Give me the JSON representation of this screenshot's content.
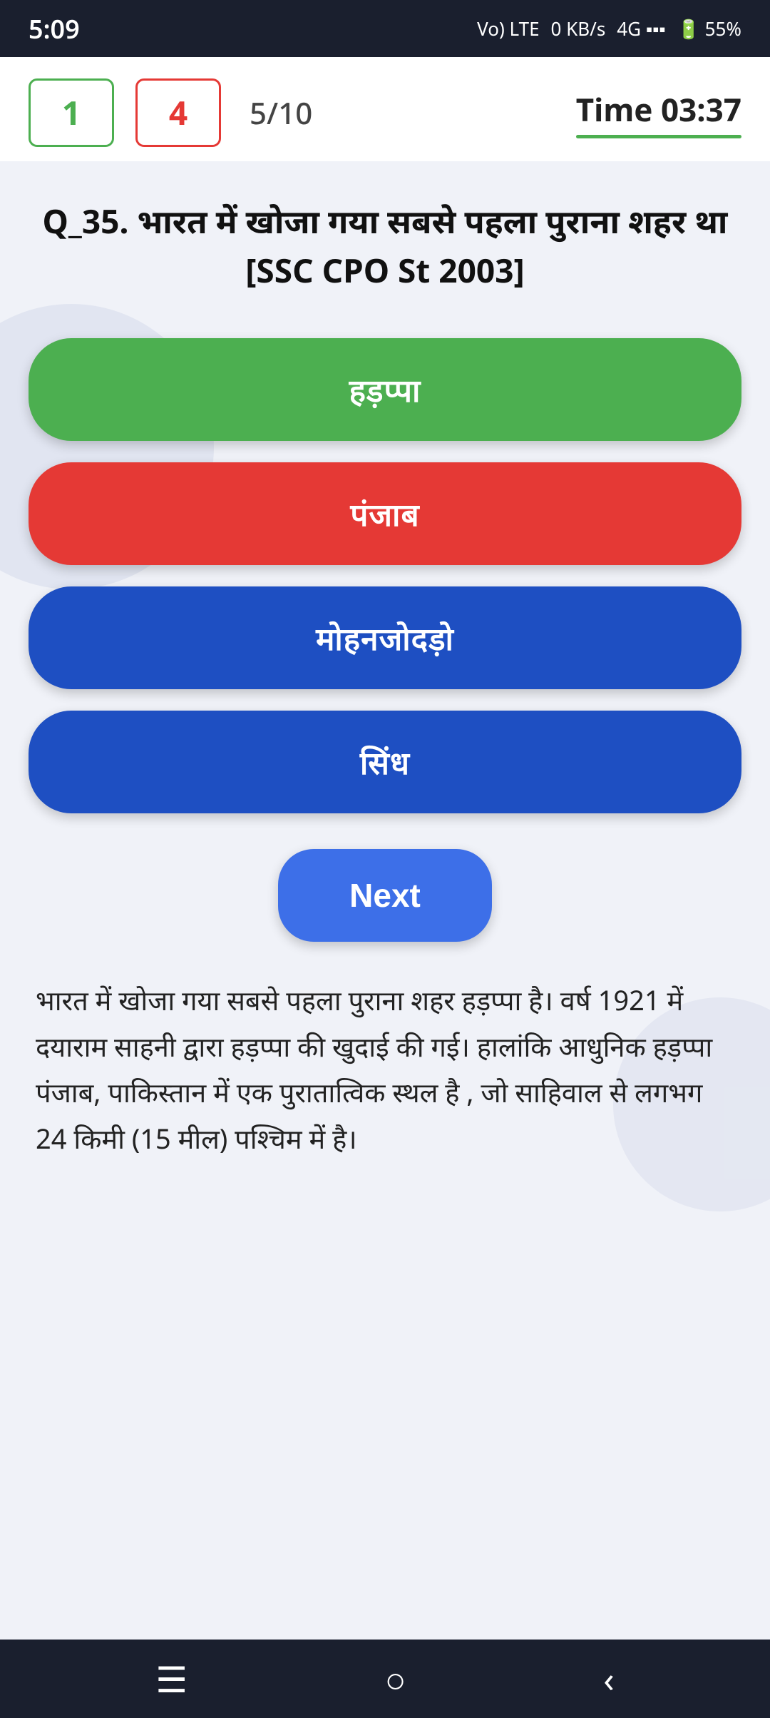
{
  "statusBar": {
    "time": "5:09",
    "signal": "Vo) LTE",
    "data": "0 KB/s",
    "network": "4G",
    "battery": "55%"
  },
  "header": {
    "correctCount": "1",
    "wrongCount": "4",
    "progress": "5/10",
    "timerLabel": "Time 03:37"
  },
  "question": {
    "text": "Q_35. भारत में खोजा गया सबसे पहला पुराना शहर था\n[SSC CPO St 2003]"
  },
  "options": [
    {
      "label": "हड़प्पा",
      "color": "green"
    },
    {
      "label": "पंजाब",
      "color": "red"
    },
    {
      "label": "मोहनजोदड़ो",
      "color": "blue"
    },
    {
      "label": "सिंध",
      "color": "blue"
    }
  ],
  "nextButton": {
    "label": "Next"
  },
  "explanation": {
    "text": "भारत में खोजा गया सबसे पहला पुराना शहर हड़प्पा है। वर्ष 1921 में दयाराम साहनी द्वारा हड़प्पा की खुदाई की गई।  हालांकि आधुनिक हड़प्पा पंजाब, पाकिस्तान में एक पुरातात्विक स्थल है , जो साहिवाल से लगभग 24 किमी (15 मील) पश्चिम में है।"
  },
  "bottomNav": {
    "menuIcon": "☰",
    "homeIcon": "○",
    "backIcon": "‹"
  }
}
